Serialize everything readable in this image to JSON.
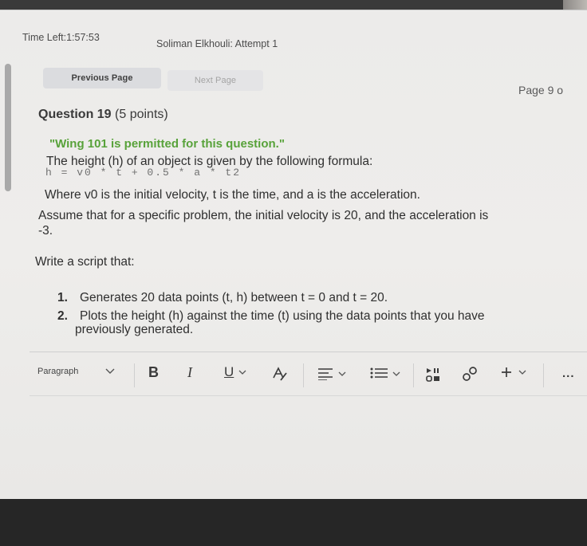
{
  "header": {
    "timer": "Time Left:1:57:53",
    "attempt": "Soliman Elkhouli: Attempt 1"
  },
  "nav": {
    "previous_label": "Previous Page",
    "next_label": "Next Page",
    "page_indicator": "Page 9 o"
  },
  "question": {
    "number_label": "Question 19",
    "points": "(5 points)",
    "permitted": "\"Wing 101 is permitted for this question.\"",
    "intro": "The height (h) of an object is given by the following formula:",
    "formula": "h = v0 * t + 0.5 * a * t2",
    "where": "Where v0 is the initial velocity, t is the time, and a is the acceleration.",
    "assume_line1": "Assume that for a specific problem, the initial velocity is 20, and the acceleration is",
    "assume_line2": "-3.",
    "write": "Write a script that:",
    "items": [
      {
        "num": "1.",
        "line1": "Generates 20 data points (t, h) between t = 0 and t = 20.",
        "line2": ""
      },
      {
        "num": "2.",
        "line1": "Plots the height (h) against the time (t) using the data points that you have",
        "line2": "previously generated."
      }
    ]
  },
  "editor": {
    "format_select": "Paragraph",
    "bold": "B",
    "italic": "I",
    "underline": "U",
    "more": "..."
  }
}
